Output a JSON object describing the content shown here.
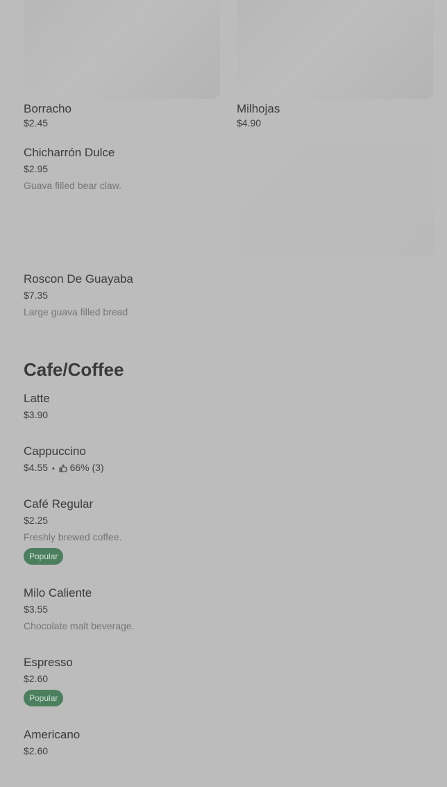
{
  "grid": [
    {
      "title": "Borracho",
      "price": "$2.45"
    },
    {
      "title": "Milhojas",
      "price": "$4.90"
    }
  ],
  "pastries": [
    {
      "name": "Chicharrón Dulce",
      "price": "$2.95",
      "description": "Guava filled bear claw."
    },
    {
      "name": "Roscon De Guayaba",
      "price": "$7.35",
      "description": "Large guava filled bread"
    }
  ],
  "section": {
    "title": "Cafe/Coffee"
  },
  "coffee": [
    {
      "name": "Latte",
      "price": "$3.90"
    },
    {
      "name": "Cappuccino",
      "price": "$4.55",
      "separator": "•",
      "rating": "66% (3)",
      "rating_icon": "thumbs-up-icon"
    },
    {
      "name": "Café Regular",
      "price": "$2.25",
      "description": "Freshly brewed coffee.",
      "badge": "Popular"
    },
    {
      "name": "Milo Caliente",
      "price": "$3.55",
      "description": "Chocolate malt beverage."
    },
    {
      "name": "Espresso",
      "price": "$2.60",
      "badge": "Popular"
    },
    {
      "name": "Americano",
      "price": "$2.60"
    }
  ],
  "colors": {
    "background": "#bcbcbc",
    "badge": "#4b7f5e"
  }
}
